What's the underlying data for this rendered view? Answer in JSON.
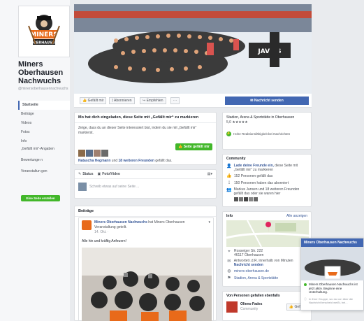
{
  "page": {
    "name_line1": "Miners",
    "name_line2": "Oberhausen",
    "name_line3": "Nachwuchs",
    "handle": "@minersoberhausennachwuchs"
  },
  "logo": {
    "text_top": "MINERS",
    "text_bottom": "OBERHAUSEN"
  },
  "nav": [
    "Startseite",
    "Beiträge",
    "Videos",
    "Fotos",
    "Info",
    "„Gefällt mir“-Angaben",
    "Bewertunge n",
    "Veranstaltun gen"
  ],
  "create_page_button": "Eine Seite erstellen",
  "cover": {
    "banner_text": "JAVICS"
  },
  "actions": {
    "like": "Gefällt mir",
    "follow": "Abonnieren",
    "share": "Empfehlen",
    "more": "···",
    "message": "Nachricht senden"
  },
  "invite": {
    "title": "Mo hat dich eingeladen, diese Seite mit „Gefällt mir“ zu markieren",
    "body": "Zeige, dass du an dieser Seite interessiert bist, indem du sie mit „Gefällt mir“ markierst.",
    "button": "Seite gefällt mir",
    "friends_prefix": "Natascha Hegmann",
    "friends_middle": "und",
    "friends_link": "18 weiteren Freunden",
    "friends_suffix": "gefällt das."
  },
  "composer": {
    "status": "Status",
    "photo": "Foto/Video",
    "placeholder": "Schreib etwas auf seine Seite ..."
  },
  "posts": {
    "header": "Beiträge",
    "author": "Miners Oberhausen Nachwuchs",
    "action": "hat Miners Oberhausen Veranstaltung geteilt.",
    "date": "14. Okt. ·",
    "text": "Alle hin und kräftig Anfeuern!"
  },
  "about": {
    "category": "Stadion, Arena & Sportstätte in Oberhausen",
    "rating": "5,0 ★★★★★",
    "response": "Hohe Reaktionsfähigkeit bei Nachrichten"
  },
  "community": {
    "header": "Community",
    "invite_link": "Lade deine Freunde ein,",
    "invite_text": "diese Seite mit „Gefällt mir“ zu markieren",
    "likes": "152 Personen gefällt das",
    "follows": "150 Personen haben das abonniert",
    "friends": "Markus Jansen und 18 weiteren Freunden gefällt das oder sie waren hier"
  },
  "info": {
    "header": "Info",
    "all": "Alle anzeigen",
    "address_line1": "Rosseiger Str. 222",
    "address_line2": "46117 Oberhausen",
    "reply": "Antwortet i.d.R. innerhalb von Minuten",
    "send_message": "Nachricht senden",
    "website": "miners-oberhausen.de",
    "category": "Stadion, Arena & Sportstätte"
  },
  "people": {
    "header": "Von Personen gefallen ebenfalls",
    "name": "Oliens-Fades",
    "sub": "Community",
    "button": "Gefällt"
  },
  "chat": {
    "title": "Miners Oberhausen Nachwuchs",
    "line1": "Miners Oberhausen Nachwuchs ist jetzt aktiv. Beginne eine Unterhaltung.",
    "line2": "In Ihrer Gruppe, wo du von über die Nachricht bescheid weißt, bei..."
  }
}
